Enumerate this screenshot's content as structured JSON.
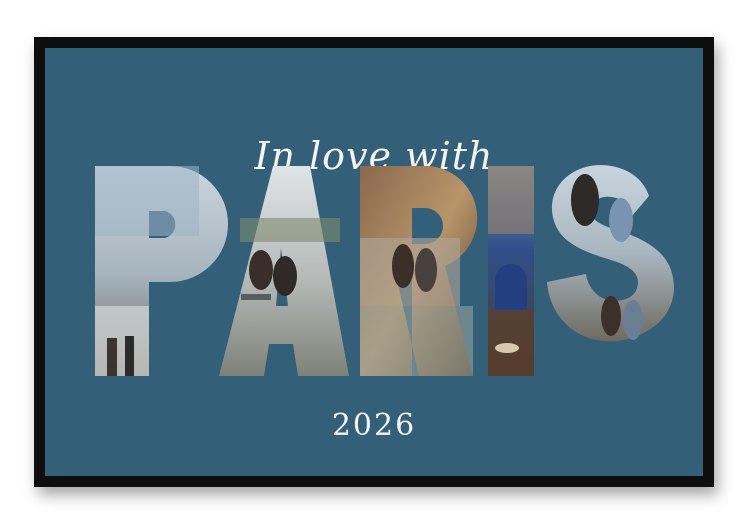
{
  "poster": {
    "headline": "In love with",
    "city": "PARIS",
    "year": "2026"
  },
  "colors": {
    "frame": "#0e0e0e",
    "background": "#345f78",
    "text": "#f4f4f4"
  }
}
